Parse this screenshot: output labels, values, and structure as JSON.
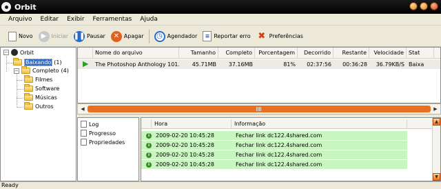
{
  "window": {
    "title": "Orbit"
  },
  "menu": [
    "Arquivo",
    "Editar",
    "Exibir",
    "Ferramentas",
    "Ajuda"
  ],
  "toolbar": {
    "novo": "Novo",
    "iniciar": "Iniciar",
    "pausar": "Pausar",
    "apagar": "Apagar",
    "agendador": "Agendador",
    "reportar": "Reportar erro",
    "preferencias": "Preferências"
  },
  "tree": {
    "root": "Orbit",
    "baixando": "Baixando",
    "baixando_count": "(1)",
    "completo": "Completo",
    "completo_count": "(4)",
    "children": [
      "Filmes",
      "Software",
      "Músicas",
      "Outros"
    ]
  },
  "downloads": {
    "columns": [
      "Nome do arquivo",
      "Tamanho",
      "Completo",
      "Porcentagem",
      "Decorrido",
      "Restante",
      "Velocidade",
      "Stat"
    ],
    "rows": [
      {
        "name": "The Photoshop Anthology 101...",
        "size": "45.71MB",
        "completed": "37.16MB",
        "percent": "81%",
        "elapsed": "02:37:56",
        "remaining": "00:36:28",
        "speed": "36.79KB/S",
        "status": "Baixa"
      }
    ]
  },
  "detail_tabs": [
    "Log",
    "Progresso",
    "Propriedades"
  ],
  "log": {
    "columns": [
      "Hora",
      "Informação"
    ],
    "rows": [
      {
        "time": "2009-02-20 10:45:28",
        "info": "Fechar link dc122.4shared.com"
      },
      {
        "time": "2009-02-20 10:45:28",
        "info": "Fechar link dc122.4shared.com"
      },
      {
        "time": "2009-02-20 10:45:28",
        "info": "Fechar link dc122.4shared.com"
      },
      {
        "time": "2009-02-20 10:45:28",
        "info": "Fechar link dc122.4shared.com"
      }
    ]
  },
  "status": "Ready",
  "colors": {
    "accent": "#e87020",
    "log_row": "#c9f5c0",
    "selection": "#316ac5"
  }
}
